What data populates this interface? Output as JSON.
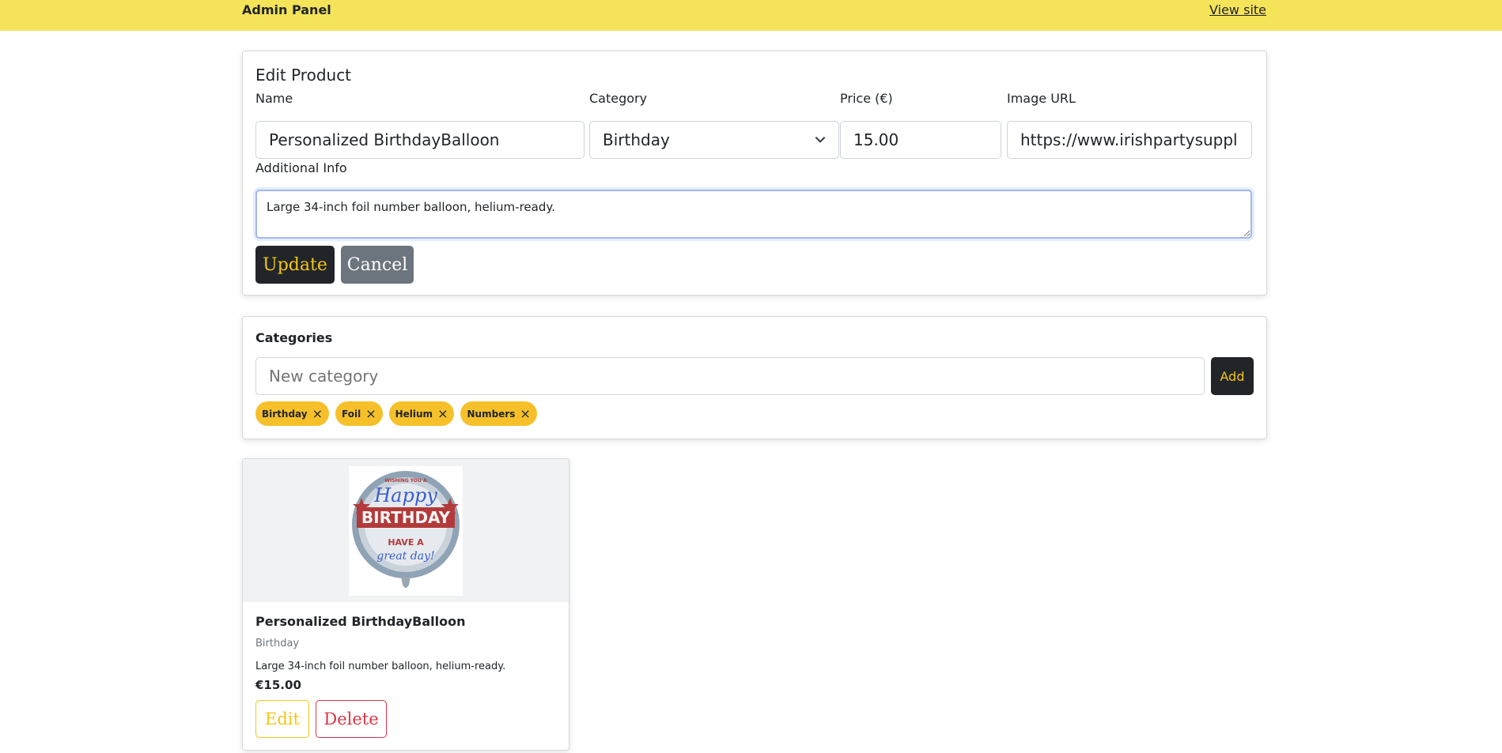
{
  "header": {
    "brand": "Admin Panel",
    "view_site": "View site"
  },
  "edit_form": {
    "title": "Edit Product",
    "name_label": "Name",
    "name_value": "Personalized BirthdayBalloon",
    "category_label": "Category",
    "category_value": "Birthday",
    "price_label": "Price (€)",
    "price_value": "15.00",
    "image_label": "Image URL",
    "image_value": "https://www.irishpartysupplies.ie",
    "info_label": "Additional Info",
    "info_value": "Large 34-inch foil number balloon, helium-ready.",
    "update_label": "Update",
    "cancel_label": "Cancel"
  },
  "categories": {
    "title": "Categories",
    "input_placeholder": "New category",
    "add_label": "Add",
    "chips": [
      "Birthday",
      "Foil",
      "Helium",
      "Numbers"
    ],
    "remove_symbol": "×"
  },
  "product": {
    "name": "Personalized BirthdayBalloon",
    "category": "Birthday",
    "description": "Large 34-inch foil number balloon, helium-ready.",
    "price": "€15.00",
    "edit_label": "Edit",
    "delete_label": "Delete",
    "image_text": {
      "top": "WISHING YOU A",
      "happy": "Happy",
      "birthday": "BIRTHDAY",
      "have_a": "HAVE A",
      "great_day": "great day!"
    }
  },
  "colors": {
    "header_bg": "#f5e35a",
    "accent": "#f5c518",
    "chip_bg": "#f5c02a",
    "dark": "#212529",
    "danger": "#dc3545"
  }
}
